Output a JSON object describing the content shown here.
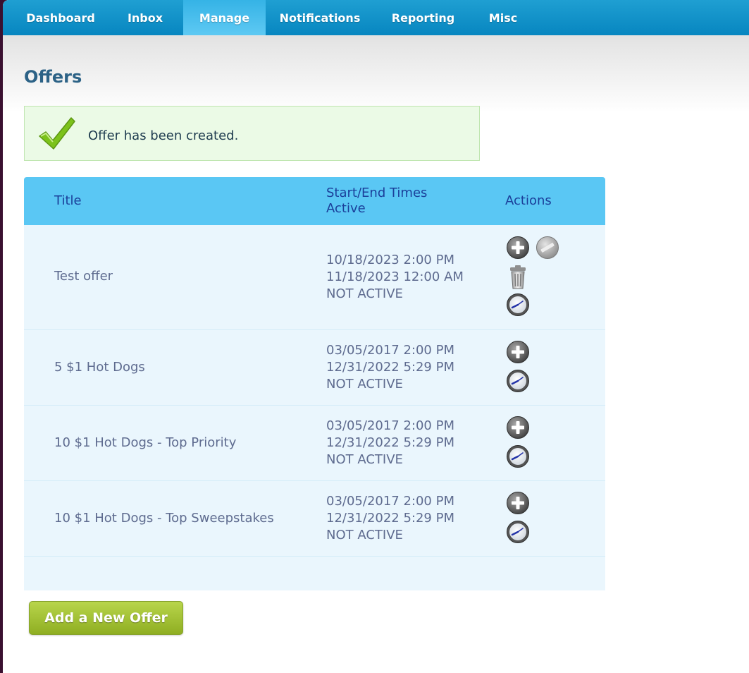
{
  "nav": {
    "items": [
      {
        "label": "Dashboard"
      },
      {
        "label": "Inbox"
      },
      {
        "label": "Manage"
      },
      {
        "label": "Notifications"
      },
      {
        "label": "Reporting"
      },
      {
        "label": "Misc"
      }
    ],
    "active": "Manage"
  },
  "page": {
    "title": "Offers",
    "alert": "Offer has been created.",
    "add_button": "Add a New Offer"
  },
  "table": {
    "headers": {
      "title": "Title",
      "times_line1": "Start/End Times",
      "times_line2": "Active",
      "actions": "Actions"
    },
    "rows": [
      {
        "title": "Test offer",
        "start": "10/18/2023 2:00 PM",
        "end": "11/18/2023 12:00 AM",
        "status": "NOT ACTIVE",
        "actions": [
          "add-icon",
          "disabled-icon",
          "trash-icon",
          "clock-icon"
        ]
      },
      {
        "title": "5 $1 Hot Dogs",
        "start": "03/05/2017 2:00 PM",
        "end": "12/31/2022 5:29 PM",
        "status": "NOT ACTIVE",
        "actions": [
          "add-icon",
          "clock-icon"
        ]
      },
      {
        "title": "10 $1 Hot Dogs - Top Priority",
        "start": "03/05/2017 2:00 PM",
        "end": "12/31/2022 5:29 PM",
        "status": "NOT ACTIVE",
        "actions": [
          "add-icon",
          "clock-icon"
        ]
      },
      {
        "title": "10 $1 Hot Dogs - Top Sweepstakes",
        "start": "03/05/2017 2:00 PM",
        "end": "12/31/2022 5:29 PM",
        "status": "NOT ACTIVE",
        "actions": [
          "add-icon",
          "clock-icon"
        ]
      }
    ]
  },
  "colors": {
    "nav_bg": "#0a8ac4",
    "title": "#2c6286",
    "header_bg": "#5ac7f4",
    "row_bg": "#eaf6fd",
    "button": "#a3c234"
  }
}
